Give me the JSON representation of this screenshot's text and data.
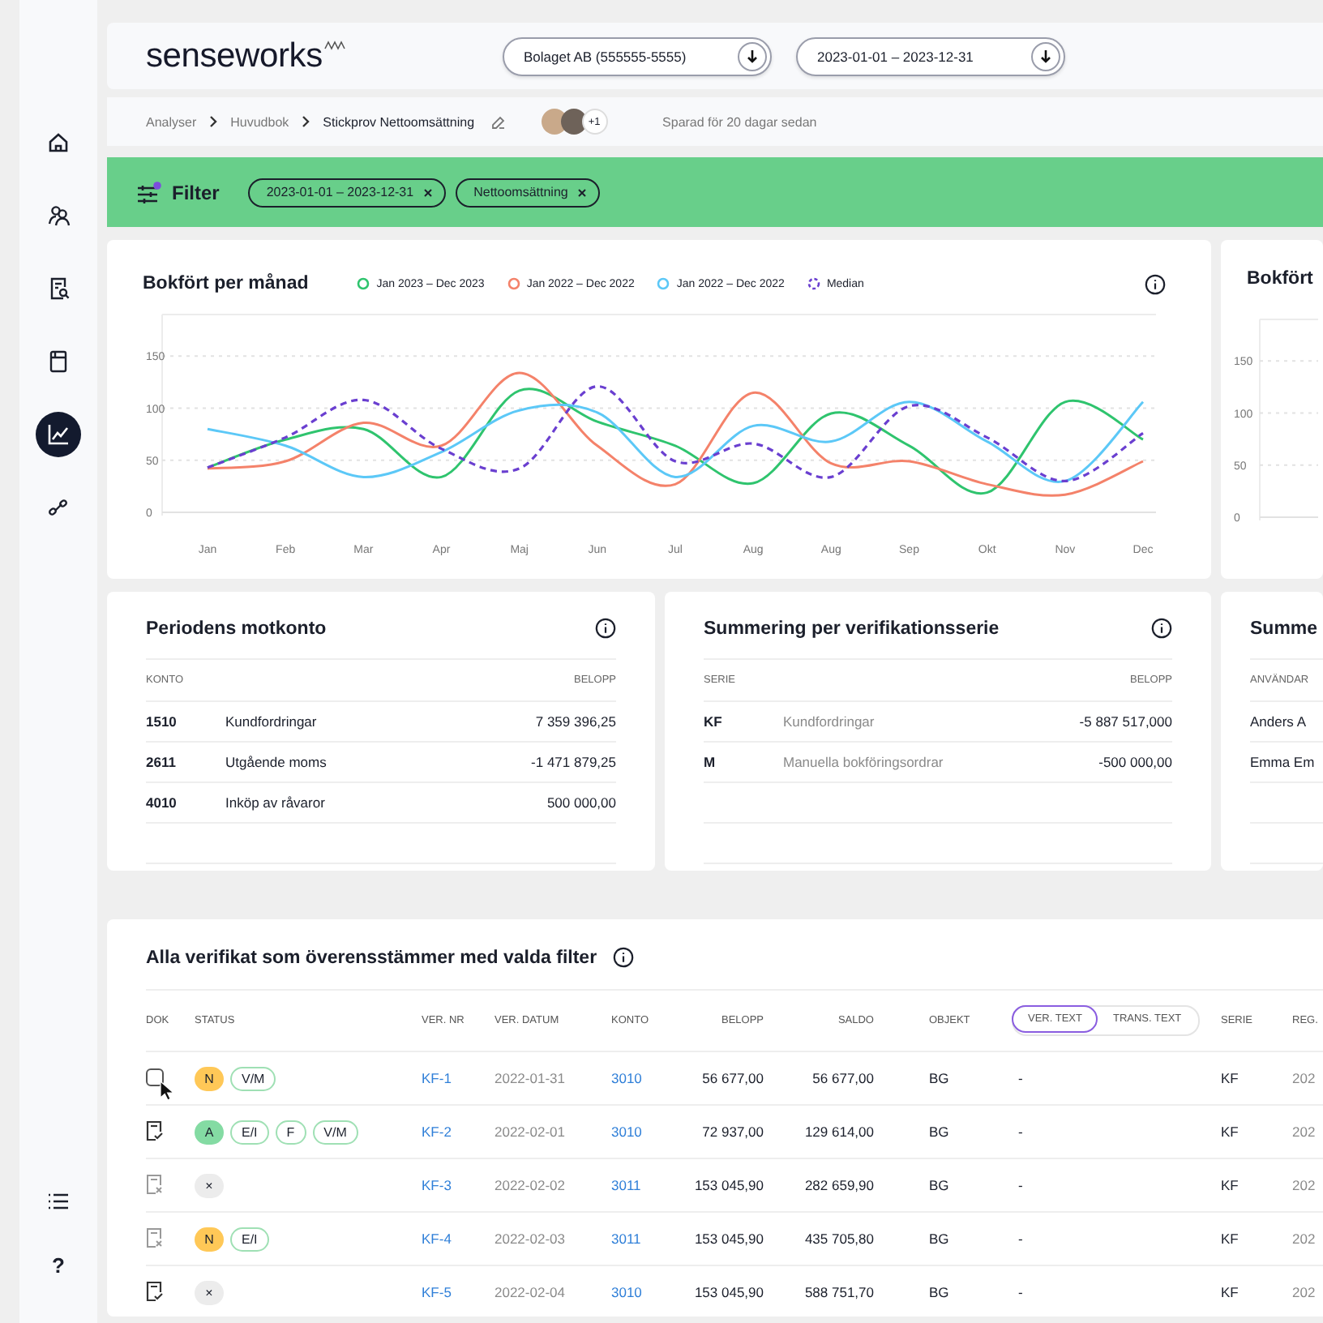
{
  "sidebar": {
    "items": [
      {
        "selected": false
      },
      {
        "selected": false
      },
      {
        "selected": false
      },
      {
        "selected": false
      },
      {
        "selected": true
      },
      {
        "selected": false
      }
    ],
    "help_label": "?"
  },
  "header": {
    "logo": "senseworks",
    "company_select": {
      "value": "Bolaget AB (555555-5555)"
    },
    "period_select": {
      "value": "2023-01-01 – 2023-12-31"
    }
  },
  "breadcrumbs": [
    {
      "label": "Analyser",
      "current": false
    },
    {
      "label": "Huvudbok",
      "current": false
    },
    {
      "label": "Stickprov Nettoomsättning",
      "current": true
    }
  ],
  "collaborators": {
    "extra_count": "+1"
  },
  "saved_note": "Sparad för 20 dagar sedan",
  "filter": {
    "label": "Filter",
    "active": true,
    "chips": [
      {
        "label": "2023-01-01 – 2023-12-31"
      },
      {
        "label": "Nettoomsättning"
      }
    ]
  },
  "chart_card": {
    "title": "Bokfört per månad",
    "chart_data": {
      "type": "line",
      "categories": [
        "Jan",
        "Feb",
        "Mar",
        "Apr",
        "Maj",
        "Jun",
        "Jul",
        "Aug",
        "Aug",
        "Sep",
        "Okt",
        "Nov",
        "Dec"
      ],
      "ylim": [
        0,
        190
      ],
      "yticks": [
        0,
        50,
        100,
        150
      ],
      "grid": true,
      "series": [
        {
          "name": "Jan 2023 – Dec 2023",
          "color": "#2fc46e",
          "line_style": "solid",
          "values": [
            43,
            70,
            80,
            34,
            117,
            87,
            64,
            28,
            95,
            64,
            19,
            106,
            70
          ]
        },
        {
          "name": "Jan 2022 – Dec 2022",
          "color": "#f4826a",
          "line_style": "solid",
          "values": [
            42,
            49,
            86,
            64,
            134,
            64,
            27,
            115,
            47,
            49,
            27,
            17,
            49
          ]
        },
        {
          "name": "Jan 2022 – Dec 2022",
          "color": "#5cc8f7",
          "line_style": "solid",
          "values": [
            80,
            64,
            34,
            58,
            98,
            96,
            34,
            83,
            68,
            106,
            68,
            30,
            106
          ]
        },
        {
          "name": "Median",
          "color": "#6a3fd0",
          "line_style": "dashed",
          "values": [
            43,
            72,
            108,
            61,
            42,
            121,
            49,
            66,
            34,
            102,
            72,
            30,
            76
          ]
        }
      ]
    }
  },
  "side_chart_card": {
    "title": "Bokfört",
    "chart_data": {
      "type": "line",
      "categories": [
        null
      ],
      "ylim": [
        0,
        190
      ],
      "yticks": [
        0,
        50,
        100,
        150
      ],
      "grid": true
    }
  },
  "account_card": {
    "title": "Periodens motkonto",
    "columns": [
      "KONTO",
      "BELOPP"
    ],
    "rows": [
      {
        "code": "1510",
        "name": "Kundfordringar",
        "amount": "7 359 396,25"
      },
      {
        "code": "2611",
        "name": "Utgående moms",
        "amount": "-1 471 879,25"
      },
      {
        "code": "4010",
        "name": "Inköp av råvaror",
        "amount": "500 000,00"
      }
    ]
  },
  "series_card": {
    "title": "Summering per verifikationsserie",
    "columns": [
      "SERIE",
      "BELOPP"
    ],
    "rows": [
      {
        "code": "KF",
        "name": "Kundfordringar",
        "amount": "-5 887 517,000"
      },
      {
        "code": "M",
        "name": "Manuella bokföringsordrar",
        "amount": "-500 000,00"
      }
    ]
  },
  "user_card": {
    "title": "Summe",
    "columns": [
      "ANVÄNDAR"
    ],
    "rows": [
      {
        "user": "Anders A"
      },
      {
        "user": "Emma Em"
      }
    ]
  },
  "transactions": {
    "title": "Alla verifikat som överensstämmer med valda filter",
    "columns": [
      "DOK",
      "STATUS",
      "VER. NR",
      "VER. DATUM",
      "KONTO",
      "BELOPP",
      "SALDO",
      "OBJEKT",
      "SERIE",
      "REG."
    ],
    "text_toggle": [
      {
        "label": "VER. TEXT",
        "selected": true
      },
      {
        "label": "TRANS. TEXT",
        "selected": false
      }
    ],
    "rows": [
      {
        "doc": {
          "kind": "checkbox",
          "checked": false
        },
        "statuses": [
          {
            "label": "N",
            "kind": "filled",
            "color": "#ffc857"
          },
          {
            "label": "V/M",
            "kind": "outline"
          }
        ],
        "ver_nr": "KF-1",
        "ver_date": "2022-01-31",
        "account": "3010",
        "amount": "56 677,00",
        "balance": "56 677,00",
        "object": "BG",
        "text": "-",
        "series": "KF",
        "reg": "202"
      },
      {
        "doc": {
          "kind": "attached"
        },
        "statuses": [
          {
            "label": "A",
            "kind": "filled",
            "color": "#84dba3"
          },
          {
            "label": "E/I",
            "kind": "outline"
          },
          {
            "label": "F",
            "kind": "outline"
          },
          {
            "label": "V/M",
            "kind": "outline"
          }
        ],
        "ver_nr": "KF-2",
        "ver_date": "2022-02-01",
        "account": "3010",
        "amount": "72 937,00",
        "balance": "129 614,00",
        "object": "BG",
        "text": "-",
        "series": "KF",
        "reg": "202"
      },
      {
        "doc": {
          "kind": "missing"
        },
        "statuses": [
          {
            "label": "×",
            "kind": "filled",
            "color": "#ececec"
          }
        ],
        "ver_nr": "KF-3",
        "ver_date": "2022-02-02",
        "account": "3011",
        "amount": "153 045,90",
        "balance": "282 659,90",
        "object": "BG",
        "text": "-",
        "series": "KF",
        "reg": "202"
      },
      {
        "doc": {
          "kind": "missing"
        },
        "statuses": [
          {
            "label": "N",
            "kind": "filled",
            "color": "#ffc857"
          },
          {
            "label": "E/I",
            "kind": "outline"
          }
        ],
        "ver_nr": "KF-4",
        "ver_date": "2022-02-03",
        "account": "3011",
        "amount": "153 045,90",
        "balance": "435 705,80",
        "object": "BG",
        "text": "-",
        "series": "KF",
        "reg": "202"
      },
      {
        "doc": {
          "kind": "attached"
        },
        "statuses": [
          {
            "label": "×",
            "kind": "filled",
            "color": "#ececec"
          }
        ],
        "ver_nr": "KF-5",
        "ver_date": "2022-02-04",
        "account": "3010",
        "amount": "153 045,90",
        "balance": "588 751,70",
        "object": "BG",
        "text": "-",
        "series": "KF",
        "reg": "202"
      }
    ]
  }
}
